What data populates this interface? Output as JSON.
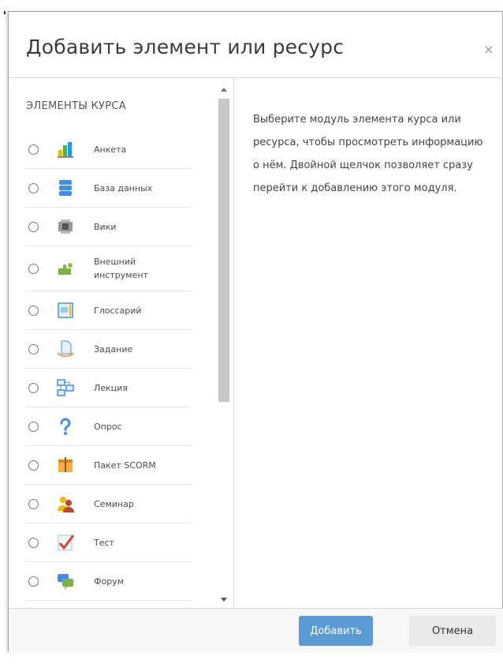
{
  "dialog": {
    "title": "Добавить элемент или ресурс",
    "close_label": "×"
  },
  "sidebar": {
    "section_title": "ЭЛЕМЕНТЫ КУРСА",
    "items": [
      {
        "label": "Анкета",
        "icon": "bar-chart-icon"
      },
      {
        "label": "База данных",
        "icon": "database-icon"
      },
      {
        "label": "Вики",
        "icon": "wiki-icon"
      },
      {
        "label": "Внешний инструмент",
        "icon": "puzzle-icon"
      },
      {
        "label": "Глоссарий",
        "icon": "glossary-icon"
      },
      {
        "label": "Задание",
        "icon": "assignment-icon"
      },
      {
        "label": "Лекция",
        "icon": "lesson-icon"
      },
      {
        "label": "Опрос",
        "icon": "question-icon"
      },
      {
        "label": "Пакет SCORM",
        "icon": "package-icon"
      },
      {
        "label": "Семинар",
        "icon": "workshop-icon"
      },
      {
        "label": "Тест",
        "icon": "quiz-icon"
      },
      {
        "label": "Форум",
        "icon": "forum-icon"
      }
    ]
  },
  "main": {
    "description": "Выберите модуль элемента курса или ресурса, чтобы просмотреть информацию о нём. Двойной щелчок позволяет сразу перейти к добавлению этого модуля."
  },
  "footer": {
    "add_label": "Добавить",
    "cancel_label": "Отмена"
  },
  "colors": {
    "primary_button": "#5b9bd5",
    "secondary_button": "#e9e9e9"
  }
}
